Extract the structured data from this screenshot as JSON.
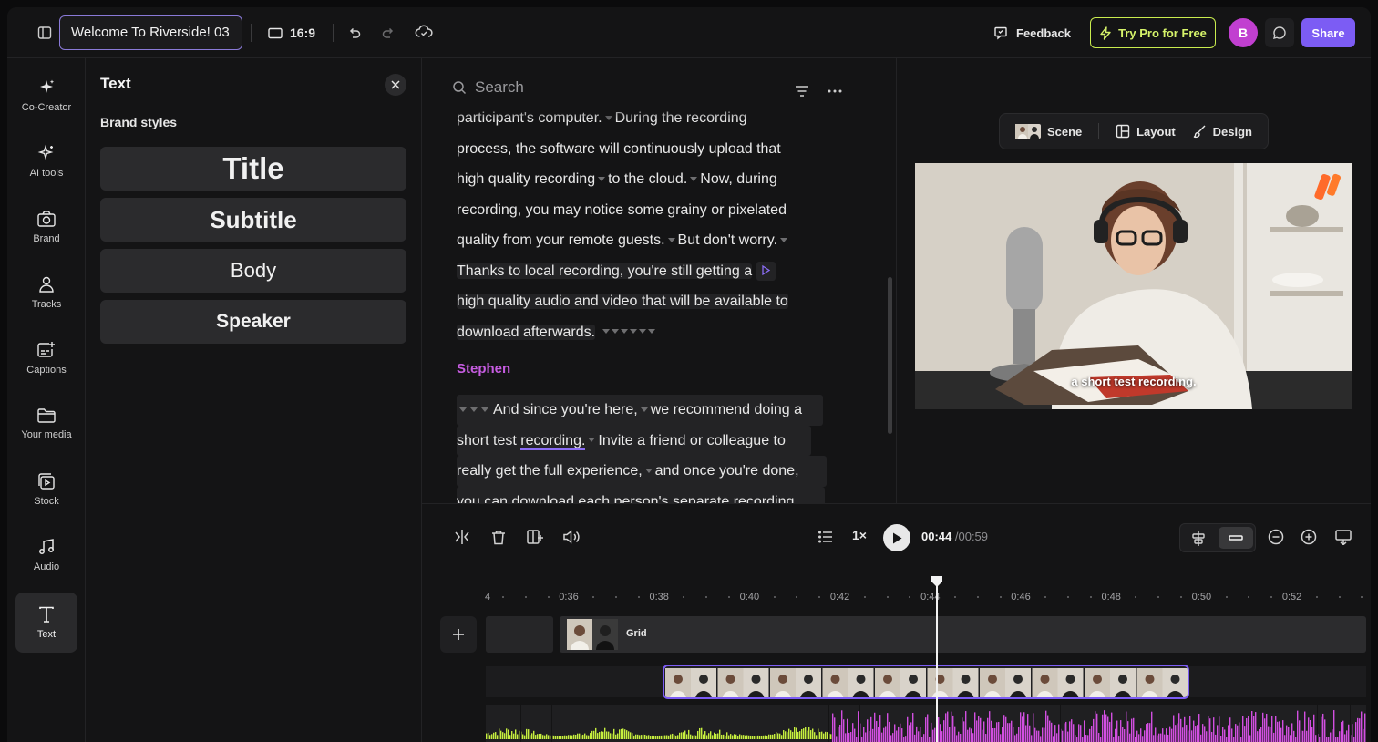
{
  "header": {
    "project_title": "Welcome To Riverside! 03",
    "aspect_ratio": "16:9",
    "feedback_label": "Feedback",
    "try_pro_label": "Try Pro for Free",
    "avatar_initial": "B",
    "share_label": "Share"
  },
  "nav": {
    "items": [
      {
        "label": "Co-Creator",
        "icon": "sparkle-icon"
      },
      {
        "label": "AI tools",
        "icon": "ai-sparkle-icon"
      },
      {
        "label": "Brand",
        "icon": "brand-camera-icon"
      },
      {
        "label": "Tracks",
        "icon": "people-icon"
      },
      {
        "label": "Captions",
        "icon": "captions-icon"
      },
      {
        "label": "Your media",
        "icon": "folder-icon"
      },
      {
        "label": "Stock",
        "icon": "stock-video-icon"
      },
      {
        "label": "Audio",
        "icon": "music-note-icon"
      },
      {
        "label": "Text",
        "icon": "text-icon"
      }
    ],
    "active": "Text"
  },
  "text_panel": {
    "title": "Text",
    "subtitle": "Brand styles",
    "styles": [
      "Title",
      "Subtitle",
      "Body",
      "Speaker"
    ]
  },
  "transcript": {
    "search_placeholder": "Search",
    "lines_top": [
      "participant's computer.",
      "During the recording",
      "process, the software will continuously upload that",
      "high quality recording",
      "to the cloud.",
      "Now, during",
      "recording, you may notice some grainy or pixelated",
      "quality from your remote guests.",
      "But don't worry.",
      "Thanks to local recording, you're still getting a",
      "high quality audio and video that will be available to",
      "download afterwards."
    ],
    "speaker": "Stephen",
    "lines_bottom": [
      "And since you're here,",
      "we recommend doing a",
      "short test",
      "recording.",
      "Invite a friend or colleague to",
      "really get the full experience,",
      "and once you're done,",
      "you can download each person's separate recording"
    ]
  },
  "preview": {
    "scene_label": "Scene",
    "layout_label": "Layout",
    "design_label": "Design",
    "caption": "a short test recording."
  },
  "timeline": {
    "speed": "1×",
    "current_time": "00:44",
    "total_time": "/00:59",
    "ruler_labels": [
      "4",
      "0:36",
      "0:38",
      "0:40",
      "0:42",
      "0:44",
      "0:46",
      "0:48",
      "0:50",
      "0:52"
    ],
    "grid_label": "Grid"
  },
  "colors": {
    "accent": "#7c5cf4",
    "pro": "#c9ec4e",
    "speaker": "#c65ce0",
    "waveform_a": "#c6ef3f",
    "waveform_b": "#d24fe0"
  }
}
